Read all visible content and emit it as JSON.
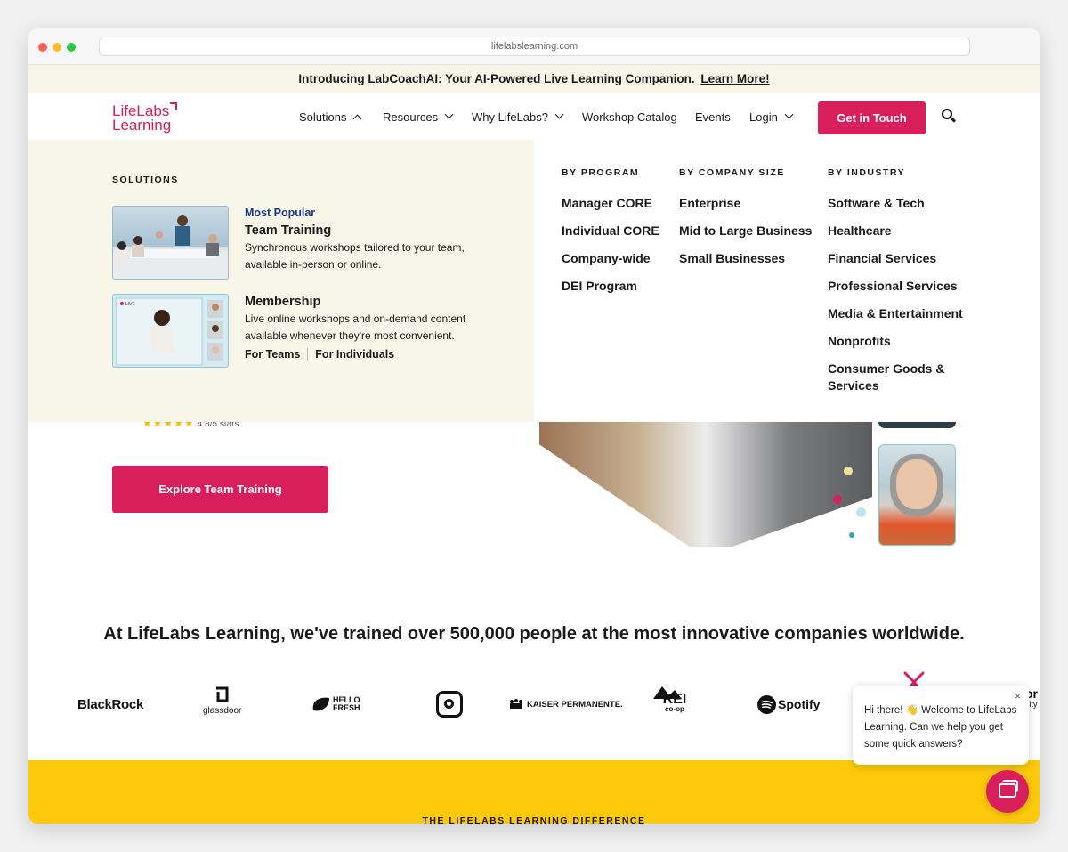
{
  "browser": {
    "url": "lifelabslearning.com"
  },
  "announcement": {
    "text": "Introducing LabCoachAI: Your AI-Powered Live Learning Companion.",
    "link": "Learn More!"
  },
  "header": {
    "logo_line1": "LifeLabs",
    "logo_line2": "Learning",
    "nav": [
      "Solutions",
      "Resources",
      "Why LifeLabs?",
      "Workshop Catalog",
      "Events",
      "Login"
    ],
    "cta": "Get in Touch"
  },
  "mega": {
    "solutions_title": "SOLUTIONS",
    "team_training": {
      "tag": "Most Popular",
      "title": "Team Training",
      "desc_line1": "Synchronous workshops tailored to your team,",
      "desc_line2": "available in-person or online."
    },
    "membership": {
      "title": "Membership",
      "desc_line1": "Live online workshops and on-demand content",
      "desc_line2": "available whenever they're most convenient.",
      "link_teams": "For Teams",
      "link_individuals": "For Individuals",
      "live_badge": "LIVE"
    },
    "by_program": {
      "title": "BY PROGRAM",
      "items": [
        "Manager CORE",
        "Individual CORE",
        "Company-wide",
        "DEI Program"
      ]
    },
    "by_company_size": {
      "title": "BY COMPANY SIZE",
      "items": [
        "Enterprise",
        "Mid to Large Business",
        "Small Businesses"
      ]
    },
    "by_industry": {
      "title": "BY INDUSTRY",
      "items": [
        "Software & Tech",
        "Healthcare",
        "Financial Services",
        "Professional Services",
        "Media & Entertainment",
        "Nonprofits",
        "Consumer Goods &",
        "Services"
      ]
    }
  },
  "hero": {
    "rating_text": "4.8/5 stars",
    "button": "Explore Team Training"
  },
  "trained_heading": "At LifeLabs Learning, we've trained over 500,000 people at the most innovative companies worldwide.",
  "logos": {
    "blackrock": "BlackRock",
    "glassdoor": "glassdoor",
    "hellofresh_1": "HELLO",
    "hellofresh_2": "FRESH",
    "kaiser": "KAISER PERMANENTE.",
    "rei": "REI",
    "rei_sub": "co-op",
    "spotify": "Spotify",
    "partial_1": "or",
    "partial_2": "sity"
  },
  "difference_label": "THE LIFELABS LEARNING DIFFERENCE",
  "chat": {
    "message": "Hi there! 👋 Welcome to LifeLabs Learning. Can we help you get some quick answers?",
    "close": "×"
  },
  "colors": {
    "brand_pink": "#d81e5b",
    "cream": "#f8f5e9",
    "yellow": "#fdc90a",
    "link_blue": "#1d3a8a"
  }
}
